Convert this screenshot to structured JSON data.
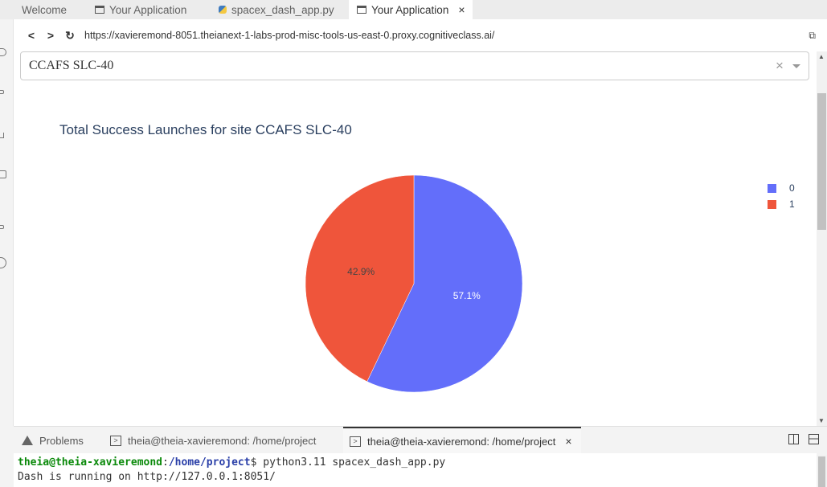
{
  "tabs": [
    {
      "label": "Welcome",
      "icon": "none",
      "active": false
    },
    {
      "label": "Your Application",
      "icon": "window-icon",
      "active": false
    },
    {
      "label": "spacex_dash_app.py",
      "icon": "python-file-icon",
      "active": false
    },
    {
      "label": "Your Application",
      "icon": "window-icon",
      "active": true,
      "close": "×"
    }
  ],
  "browser": {
    "url": "https://xavieremond-8051.theianext-1-labs-prod-misc-tools-us-east-0.proxy.cognitiveclass.ai/",
    "back": "<",
    "forward": ">",
    "reload": "↻",
    "open_external": "⧉"
  },
  "dropdown": {
    "value": "CCAFS SLC-40",
    "clear": "×"
  },
  "chart_data": {
    "type": "pie",
    "title": "Total Success Launches for site CCAFS SLC-40",
    "categories": [
      "0",
      "1"
    ],
    "values": [
      57.1,
      42.9
    ],
    "labels": [
      "57.1%",
      "42.9%"
    ],
    "colors": [
      "#636efa",
      "#ef553b"
    ],
    "legend_position": "top-right"
  },
  "panel": {
    "tabs": [
      {
        "label": "Problems",
        "icon": "warning-icon",
        "active": false
      },
      {
        "label": "theia@theia-xavieremond: /home/project",
        "icon": "terminal-icon",
        "active": false
      },
      {
        "label": "theia@theia-xavieremond: /home/project",
        "icon": "terminal-icon",
        "active": true,
        "close": "×"
      }
    ]
  },
  "terminal": {
    "prompt_user": "theia@theia-xavieremond",
    "prompt_sep": ":",
    "prompt_path": "/home/project",
    "prompt_end": "$ ",
    "command": "python3.11 spacex_dash_app.py",
    "output": "Dash is running on http://127.0.0.1:8051/"
  }
}
